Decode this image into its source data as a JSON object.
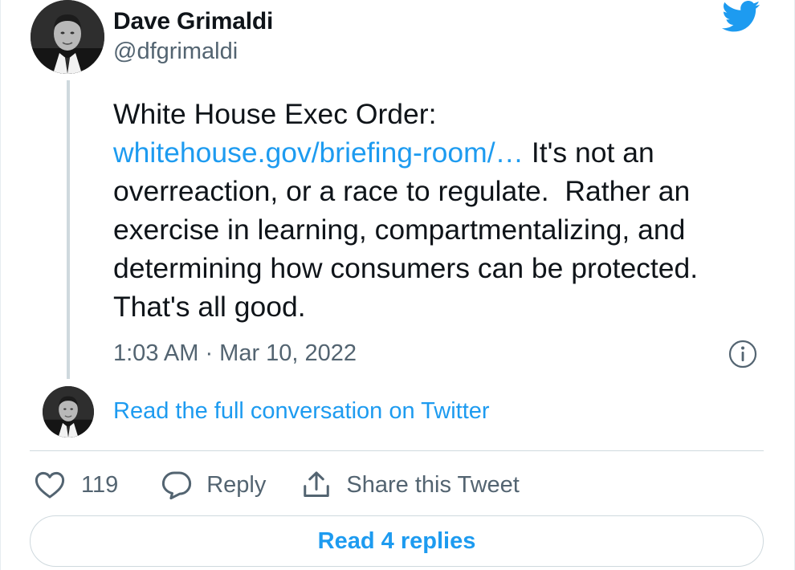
{
  "author": {
    "name": "Dave Grimaldi",
    "handle": "@dfgrimaldi"
  },
  "tweet": {
    "intro": "White House Exec Order:",
    "link_text": "whitehouse.gov/briefing-room/…",
    "body": " It's not an overreaction, or a race to regulate.  Rather an exercise in learning, compartmentalizing, and determining how consumers can be protected. That's all good.",
    "timestamp": "1:03 AM · Mar 10, 2022"
  },
  "conversation": {
    "read_full_label": "Read the full conversation on Twitter"
  },
  "actions": {
    "like_count": "119",
    "reply_label": "Reply",
    "share_label": "Share this Tweet"
  },
  "footer": {
    "read_replies_label": "Read 4 replies"
  },
  "icons": {
    "brand": "twitter-bird-icon",
    "info": "info-icon",
    "like": "heart-icon",
    "reply": "speech-bubble-icon",
    "share": "share-arrow-icon"
  },
  "colors": {
    "link": "#1d9bf0",
    "text": "#0f1419",
    "secondary": "#536471",
    "border": "#cfd9de"
  }
}
